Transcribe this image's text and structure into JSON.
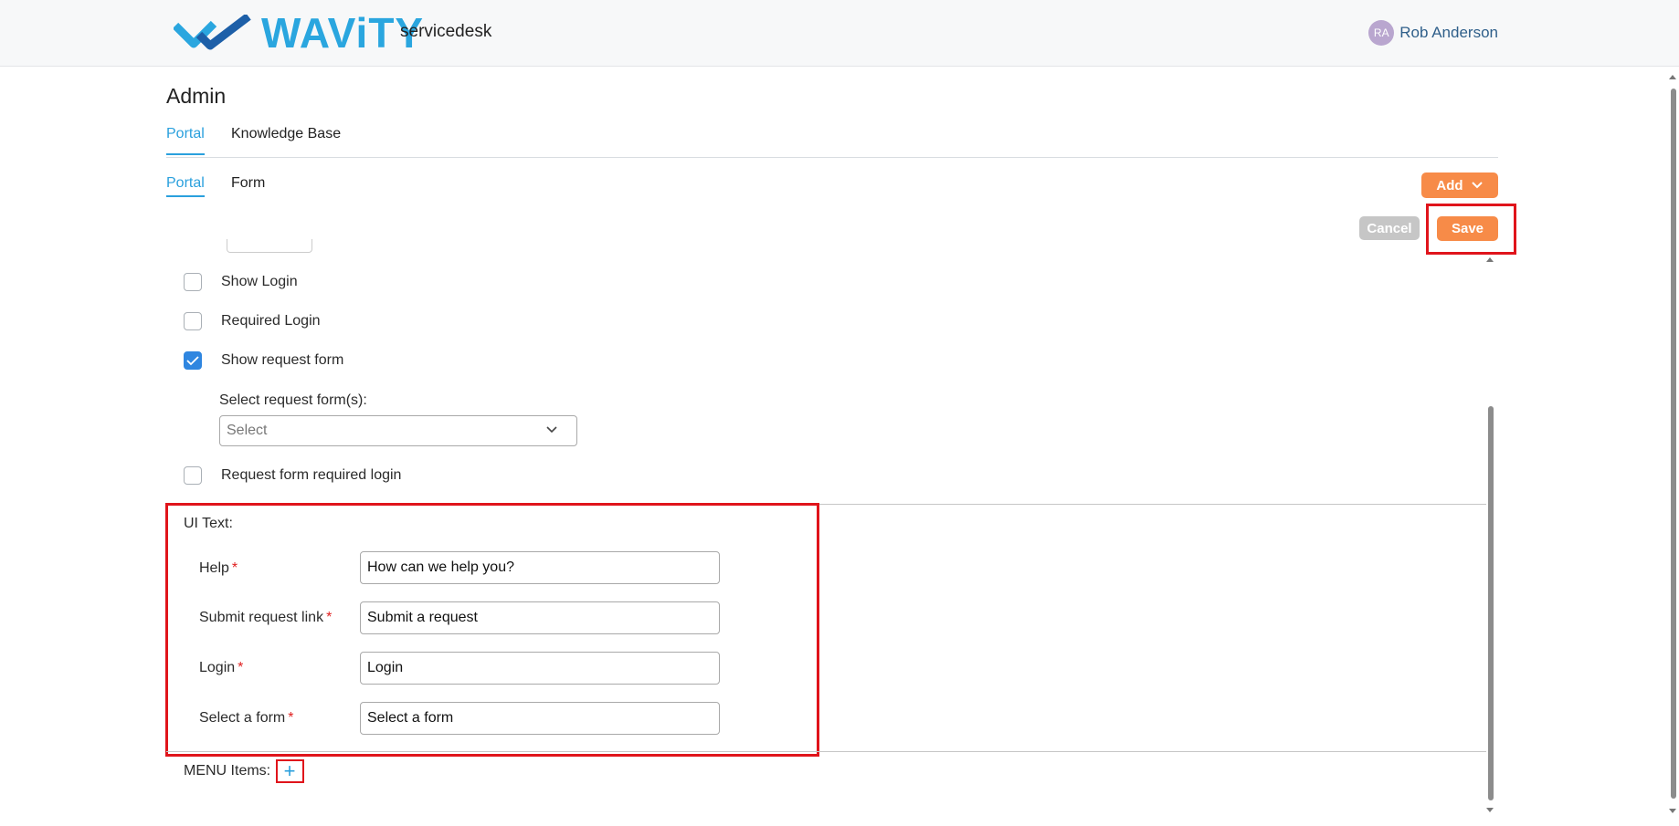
{
  "header": {
    "logo_text": "WAViTY",
    "product": "servicedesk",
    "user_initials": "RA",
    "user_name": "Rob Anderson"
  },
  "page": {
    "title": "Admin",
    "tabs": [
      "Portal",
      "Knowledge Base"
    ],
    "subtabs": [
      "Portal",
      "Form"
    ]
  },
  "actions": {
    "add": "Add",
    "cancel": "Cancel",
    "save": "Save"
  },
  "options": {
    "show_login": "Show Login",
    "required_login": "Required Login",
    "show_request_form": "Show request form",
    "select_forms_label": "Select request form(s):",
    "select_placeholder": "Select",
    "request_form_required_login": "Request form required login"
  },
  "ui_text": {
    "title": "UI Text:",
    "fields": [
      {
        "label": "Help",
        "value": "How can we help you?"
      },
      {
        "label": "Submit request link",
        "value": "Submit a request"
      },
      {
        "label": "Login",
        "value": "Login"
      },
      {
        "label": "Select a form",
        "value": "Select a form"
      }
    ]
  },
  "menu": {
    "title": "MENU Items:",
    "add_symbol": "+"
  },
  "colors": {
    "accent": "#2aa0dd",
    "orange": "#f78b48",
    "highlight": "#e0141b"
  }
}
